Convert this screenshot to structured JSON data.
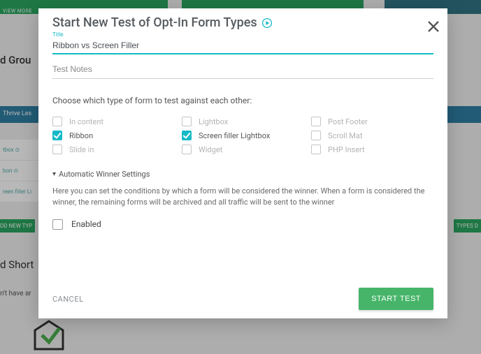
{
  "background": {
    "view_more": "VIEW MORE",
    "group_label": "d Grou",
    "blue_bar": "Thrive Les",
    "tab_lightbox": "tbox  ⊙",
    "tab_ribbon": "bon  ⊙",
    "tab_screenfiller": "reen filler Li",
    "add_new": "DD NEW TYP",
    "types_d": "TYPES D",
    "short_label": "d Short",
    "small_text": "n't have ar"
  },
  "modal": {
    "heading": "Start New Test of Opt-In Form Types",
    "title_label": "Title",
    "title_value": "Ribbon vs Screen Filler",
    "notes_placeholder": "Test Notes",
    "choose_text": "Choose which type of form to test against each other:",
    "options": {
      "in_content": "In content",
      "lightbox": "Lightbox",
      "post_footer": "Post Footer",
      "ribbon": "Ribbon",
      "screen_filler": "Screen filler Lightbox",
      "scroll_mat": "Scroll Mat",
      "slide_in": "Slide in",
      "widget": "Widget",
      "php_insert": "PHP Insert"
    },
    "disclosure": "Automatic Winner Settings",
    "aws_text": "Here you can set the conditions by which a form will be considered the winner. When a form is considered the winner, the remaining forms will be archived and all traffic will be sent to the winner",
    "enabled_label": "Enabled",
    "cancel": "CANCEL",
    "start": "START TEST"
  },
  "colors": {
    "accent": "#15b9c7",
    "primary_green": "#46b56a"
  }
}
